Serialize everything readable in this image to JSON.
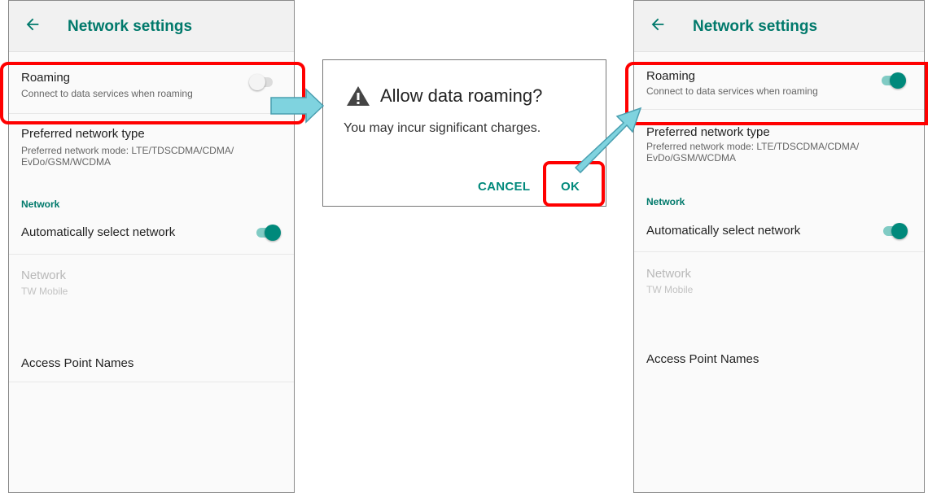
{
  "screens": {
    "before": {
      "appbar": {
        "title": "Network settings"
      },
      "roaming": {
        "title": "Roaming",
        "subtitle": "Connect to data services when roaming",
        "toggle": "off"
      },
      "preferred_network": {
        "title": "Preferred network type",
        "subtitle_line1": "Preferred network mode: LTE/TDSCDMA/CDMA/",
        "subtitle_line2": "EvDo/GSM/WCDMA"
      },
      "section_header": "Network",
      "auto_select": {
        "title": "Automatically select network",
        "toggle": "on"
      },
      "network": {
        "title": "Network",
        "subtitle": "TW Mobile"
      },
      "apn": {
        "title": "Access Point Names"
      }
    },
    "after": {
      "appbar": {
        "title": "Network settings"
      },
      "roaming": {
        "title": "Roaming",
        "subtitle": "Connect to data services when roaming",
        "toggle": "on"
      },
      "preferred_network": {
        "title": "Preferred network type",
        "subtitle_line1": "Preferred network mode: LTE/TDSCDMA/CDMA/",
        "subtitle_line2": "EvDo/GSM/WCDMA"
      },
      "section_header": "Network",
      "auto_select": {
        "title": "Automatically select network",
        "toggle": "on"
      },
      "network": {
        "title": "Network",
        "subtitle": "TW Mobile"
      },
      "apn": {
        "title": "Access Point Names"
      }
    }
  },
  "dialog": {
    "icon": "warning-icon",
    "title": "Allow data roaming?",
    "message": "You may incur significant charges.",
    "cancel_label": "CANCEL",
    "ok_label": "OK"
  },
  "icons": {
    "back": "back-arrow-icon",
    "warning": "warning-icon"
  },
  "colors": {
    "accent": "#00796b",
    "switch_on_thumb": "#00897b",
    "switch_on_track": "#80cbc4",
    "highlight": "#ff0000",
    "callout_arrow": "#7fd3df"
  }
}
